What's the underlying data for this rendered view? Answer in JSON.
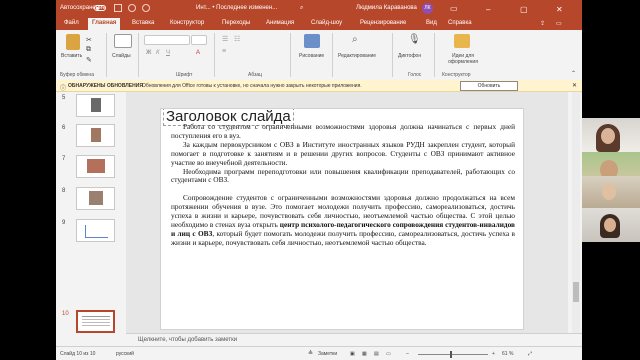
{
  "titlebar": {
    "autosave_label": "Автосохранение",
    "file_title": "Инт... • Последнее изменен...",
    "search_placeholder": "Поиск",
    "user_name": "Людмила Караванова",
    "user_initials": "ЛК"
  },
  "ribbon_tabs": [
    "Файл",
    "Главная",
    "Вставка",
    "Конструктор",
    "Переходы",
    "Анимация",
    "Слайд-шоу",
    "Рецензирование",
    "Вид",
    "Справка"
  ],
  "ribbon": {
    "paste": "Вставить",
    "slides": "Слайды",
    "drawing": "Рисование",
    "editing": "Редактирование",
    "dictaphone": "Диктофон",
    "design_ideas": "Идеи для оформления",
    "groups": {
      "clipboard": "Буфер обмена",
      "font": "Шрифт",
      "paragraph": "Абзац",
      "voice": "Голос",
      "designer": "Конструктор"
    }
  },
  "notification": {
    "title": "ОБНАРУЖЕНЫ ОБНОВЛЕНИЯ",
    "message": "Обновления для Office готовы к установке, но сначала нужно закрыть некоторые приложения.",
    "button": "Обновить"
  },
  "slide_numbers": [
    "5",
    "6",
    "7",
    "8",
    "9",
    "10"
  ],
  "slide": {
    "title": "Заголовок слайда",
    "p1": "Работа со студентом с ограниченными возможностями здоровья должна начинаться с первых дней поступления его в вуз.",
    "p2": "За каждым первокурсником с ОВЗ в Институте иностранных языков РУДН закреплен студент, который помогает в подготовке к занятиям и в решении других вопросов. Студенты с ОВЗ принимают активное участие во внеучебной деятельности.",
    "p3": "Необходима программ переподготовки или повышения квалификации преподавателей, работающих со студентами с ОВЗ.",
    "p4_a": "Сопровождение студентов с ограниченными возможностями здоровья должно продолжаться на всем протяжении обучения в вузе. Это помогает молодежи получить профессию, самореализоваться, достичь успеха в жизни и карьере, почувствовать себя личностью, неотъемлемой частью общества. С этой целью необходимо в стенах вуза открыть",
    "p4_bold": "центр психолого-педагогического сопровождения студентов-инвалидов и лиц с ОВЗ",
    "p4_b": ", который будет помогать молодежи получить профессию, самореализоваться, достичь успеха в жизни и карьере, почувствовать себя личностью, неотъемлемой частью общества."
  },
  "notes_placeholder": "Щелкните, чтобы добавить заметки",
  "status": {
    "slide_counter": "Слайд 10 из 10",
    "language": "русский",
    "notes": "Заметки",
    "zoom": "61 %"
  },
  "colors": {
    "accent": "#b7472a",
    "notification_bg": "#fff4ce"
  }
}
